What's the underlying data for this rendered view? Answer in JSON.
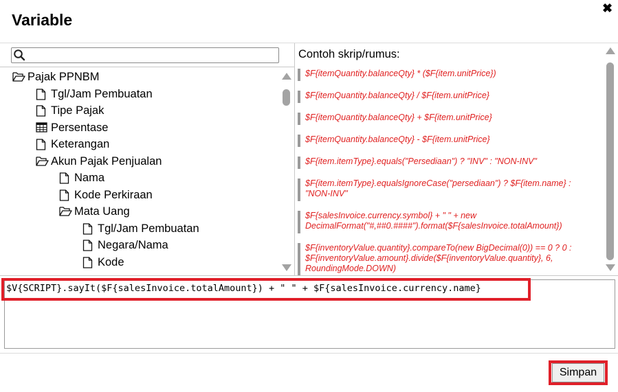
{
  "dialog": {
    "title": "Variable",
    "close_glyph": "✖"
  },
  "search": {
    "value": "",
    "placeholder": ""
  },
  "tree": [
    {
      "label": "Pajak PPNBM",
      "icon": "folder-open-icon"
    },
    {
      "label": "Tgl/Jam Pembuatan",
      "icon": "file-icon"
    },
    {
      "label": "Tipe Pajak",
      "icon": "file-icon"
    },
    {
      "label": "Persentase",
      "icon": "table-icon"
    },
    {
      "label": "Keterangan",
      "icon": "file-icon"
    },
    {
      "label": "Akun Pajak Penjualan",
      "icon": "folder-open-icon"
    },
    {
      "label": "Nama",
      "icon": "file-icon"
    },
    {
      "label": "Kode Perkiraan",
      "icon": "file-icon"
    },
    {
      "label": "Mata Uang",
      "icon": "folder-open-icon"
    },
    {
      "label": "Tgl/Jam Pembuatan",
      "icon": "file-icon"
    },
    {
      "label": "Negara/Nama",
      "icon": "file-icon"
    },
    {
      "label": "Kode",
      "icon": "file-icon"
    }
  ],
  "examples": {
    "heading": "Contoh skrip/rumus:",
    "items": [
      "$F{itemQuantity.balanceQty} * ($F{item.unitPrice})",
      "$F{itemQuantity.balanceQty} / $F{item.unitPrice}",
      "$F{itemQuantity.balanceQty} + $F{item.unitPrice}",
      "$F{itemQuantity.balanceQty} - $F{item.unitPrice}",
      "$F{item.itemType}.equals(\"Persediaan\") ? \"INV\" : \"NON-INV\"",
      "$F{item.itemType}.equalsIgnoreCase(\"persediaan\") ? $F{item.name} : \"NON-INV\"",
      "$F{salesInvoice.currency.symbol} + \" \" + new DecimalFormat(\"#,##0.####\").format($F{salesInvoice.totalAmount})",
      "$F{inventoryValue.quantity}.compareTo(new BigDecimal(0)) == 0 ? 0 : $F{inventoryValue.amount}.divide($F{inventoryValue.quantity}, 6, RoundingMode.DOWN)"
    ]
  },
  "editor": {
    "value": "$V{SCRIPT}.sayIt($F{salesInvoice.totalAmount}) + \" \" + $F{salesInvoice.currency.name}"
  },
  "actions": {
    "save_label": "Simpan"
  },
  "colors": {
    "highlight": "#e0202a",
    "example_text": "#e02020",
    "scrollbar": "#a3a3a3"
  }
}
